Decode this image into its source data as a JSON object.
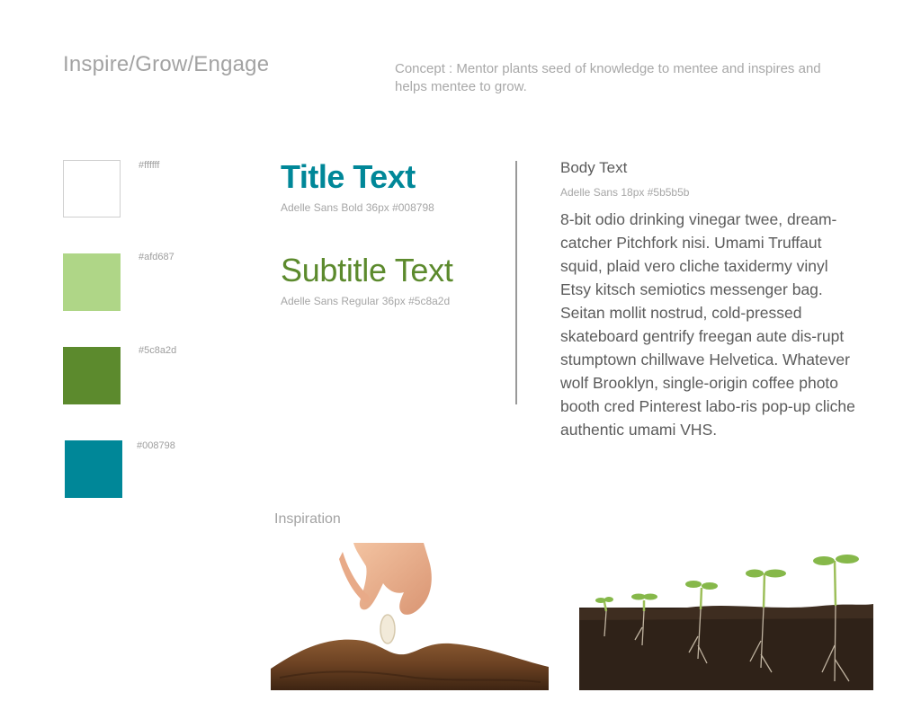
{
  "header": {
    "title": "Inspire/Grow/Engage",
    "concept": "Concept : Mentor plants seed of knowledge to mentee and inspires and helps mentee to grow."
  },
  "palette": [
    {
      "label": "#ffffff",
      "color": "#ffffff"
    },
    {
      "label": "#afd687",
      "color": "#afd687"
    },
    {
      "label": "#5c8a2d",
      "color": "#5c8a2d"
    },
    {
      "label": "#008798",
      "color": "#008798"
    }
  ],
  "typography": {
    "title_text": "Title Text",
    "title_spec": "Adelle Sans Bold 36px #008798",
    "subtitle_text": "Subtitle Text",
    "subtitle_spec": "Adelle Sans Regular 36px #5c8a2d",
    "body_heading": "Body Text",
    "body_spec": "Adelle Sans 18px #5b5b5b",
    "body_paragraph": "8-bit odio drinking vinegar twee, dream-catcher Pitchfork nisi. Umami Truffaut squid, plaid vero cliche taxidermy vinyl Etsy kitsch semiotics messenger bag. Seitan mollit nostrud, cold-pressed skateboard gentrify freegan aute dis-rupt stumptown chillwave Helvetica. Whatever wolf Brooklyn, single-origin coffee photo booth cred Pinterest labo-ris pop-up cliche authentic umami VHS."
  },
  "inspiration": {
    "label": "Inspiration",
    "images": [
      {
        "name": "hand-planting-seed"
      },
      {
        "name": "sprouting-seedlings"
      }
    ]
  }
}
